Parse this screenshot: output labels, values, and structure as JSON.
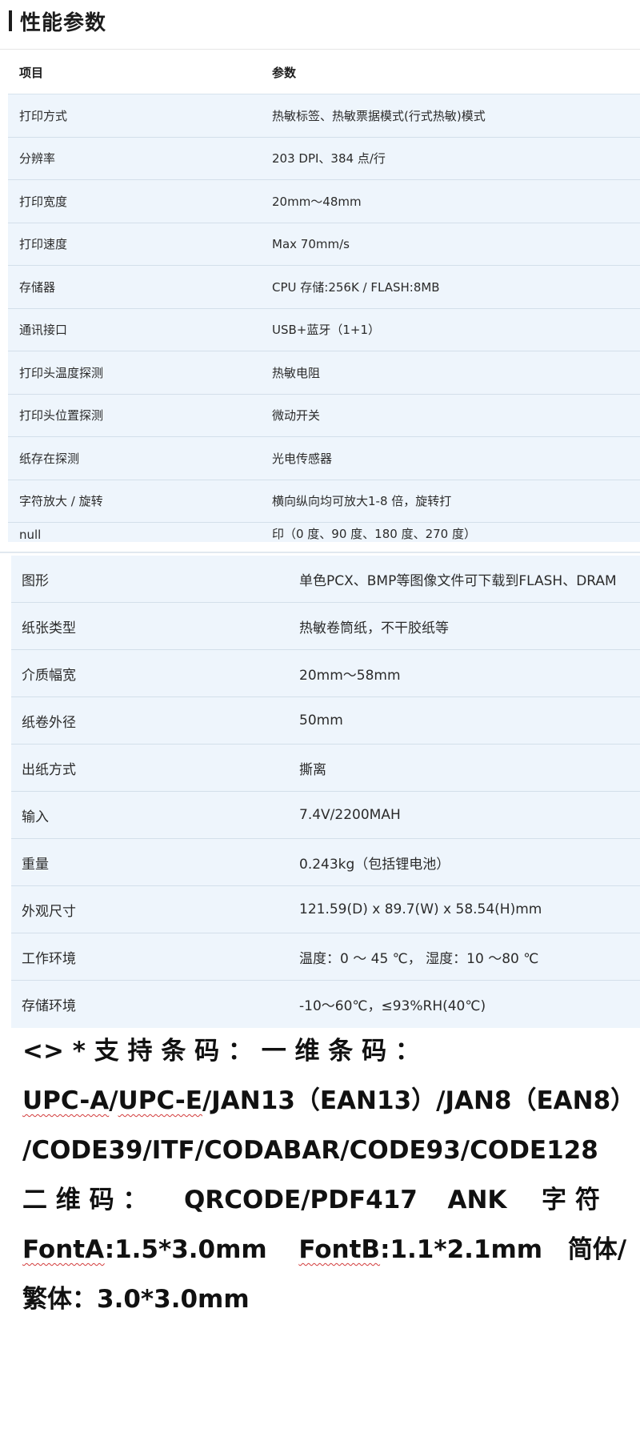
{
  "heading": {
    "title": "性能参数"
  },
  "table1": {
    "header": {
      "item": "项目",
      "param": "参数"
    },
    "rows": [
      {
        "item": "打印方式",
        "value": "热敏标签、热敏票据模式(行式热敏)模式"
      },
      {
        "item": "分辨率",
        "value": "203 DPI、384 点/行"
      },
      {
        "item": "打印宽度",
        "value": "20mm～48mm"
      },
      {
        "item": "打印速度",
        "value": "Max 70mm/s"
      },
      {
        "item": "存储器",
        "value": "CPU 存储:256K / FLASH:8MB"
      },
      {
        "item": "通讯接口",
        "value": "USB+蓝牙（1+1）"
      },
      {
        "item": "打印头温度探测",
        "value": "热敏电阻"
      },
      {
        "item": "打印头位置探测",
        "value": "微动开关"
      },
      {
        "item": "纸存在探测",
        "value": "光电传感器"
      },
      {
        "item": "字符放大 / 旋转",
        "value": "横向纵向均可放大1-8 倍，旋转打"
      },
      {
        "item": "null",
        "value": "印（0 度、90 度、180 度、270 度）"
      }
    ]
  },
  "table2": {
    "rows": [
      {
        "item": "图形",
        "value": "单色PCX、BMP等图像文件可下载到FLASH、DRAM"
      },
      {
        "item": "纸张类型",
        "value": "热敏卷筒纸，不干胶纸等"
      },
      {
        "item": "介质幅宽",
        "value": "20mm～58mm"
      },
      {
        "item": "纸卷外径",
        "value": "50mm"
      },
      {
        "item": "出纸方式",
        "value": "撕离"
      },
      {
        "item": "输入",
        "value": "7.4V/2200MAH"
      },
      {
        "item": "重量",
        "value": "0.243kg（包括锂电池）"
      },
      {
        "item": "外观尺寸",
        "value": "121.59(D) x 89.7(W) x 58.54(H)mm"
      },
      {
        "item": "工作环境",
        "value": "温度：0 ～ 45 ℃， 湿度：10 ～80 ℃"
      },
      {
        "item": "存储环境",
        "value": "-10～60℃，≤93%RH(40℃)"
      }
    ]
  },
  "barcode_text": {
    "line1": "<> * 支 持 条 码 ： 一 维 条 码 ：",
    "line2a": "UPC-A",
    "line2b": "/",
    "line2c": "UPC-E",
    "line2d": "/JAN13（EAN13）/JAN8（EAN8）",
    "line3": "/CODE39/ITF/CODABAR/CODE93/CODE128",
    "line4a": "二 维 码 ：",
    "line4b": "QRCODE/PDF417",
    "line4c": "ANK",
    "line4d": "字 符",
    "line5a": "FontA",
    "line5b": ":1.5*3.0mm",
    "line5c": "FontB",
    "line5d": ":1.1*2.1mm",
    "line5e": "简体/",
    "line6": "繁体：3.0*3.0mm"
  }
}
